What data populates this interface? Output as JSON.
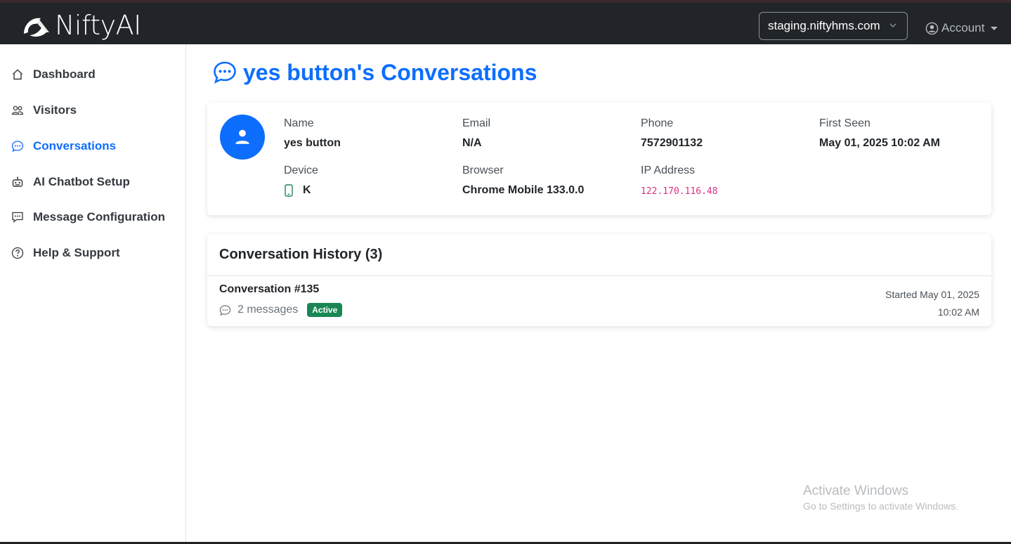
{
  "header": {
    "brand": "NiftyAI",
    "site_select": "staging.niftyhms.com",
    "account_label": "Account"
  },
  "sidebar": {
    "items": [
      {
        "label": "Dashboard",
        "icon": "house-icon"
      },
      {
        "label": "Visitors",
        "icon": "people-icon"
      },
      {
        "label": "Conversations",
        "icon": "chat-dots-icon",
        "active": true
      },
      {
        "label": "AI Chatbot Setup",
        "icon": "robot-icon"
      },
      {
        "label": "Message Configuration",
        "icon": "chat-square-dots-icon"
      },
      {
        "label": "Help & Support",
        "icon": "question-circle-icon"
      }
    ]
  },
  "page": {
    "title": "yes button's Conversations"
  },
  "visitor": {
    "name_label": "Name",
    "name": "yes button",
    "email_label": "Email",
    "email": "N/A",
    "phone_label": "Phone",
    "phone": "7572901132",
    "first_seen_label": "First Seen",
    "first_seen": "May 01, 2025 10:02 AM",
    "device_label": "Device",
    "device": "K",
    "browser_label": "Browser",
    "browser": "Chrome Mobile 133.0.0",
    "ip_label": "IP Address",
    "ip": "122.170.116.48"
  },
  "history": {
    "title": "Conversation History (3)",
    "conversations": [
      {
        "title": "Conversation #135",
        "messages": "2 messages",
        "status": "Active",
        "started_line1": "Started May 01, 2025",
        "started_line2": "10:02 AM"
      }
    ]
  },
  "watermark": {
    "line1": "Activate Windows",
    "line2": "Go to Settings to activate Windows."
  },
  "colors": {
    "accent": "#0d6efd",
    "topbar": "#212529",
    "badge_active": "#198754",
    "ip_text": "#d63384"
  }
}
